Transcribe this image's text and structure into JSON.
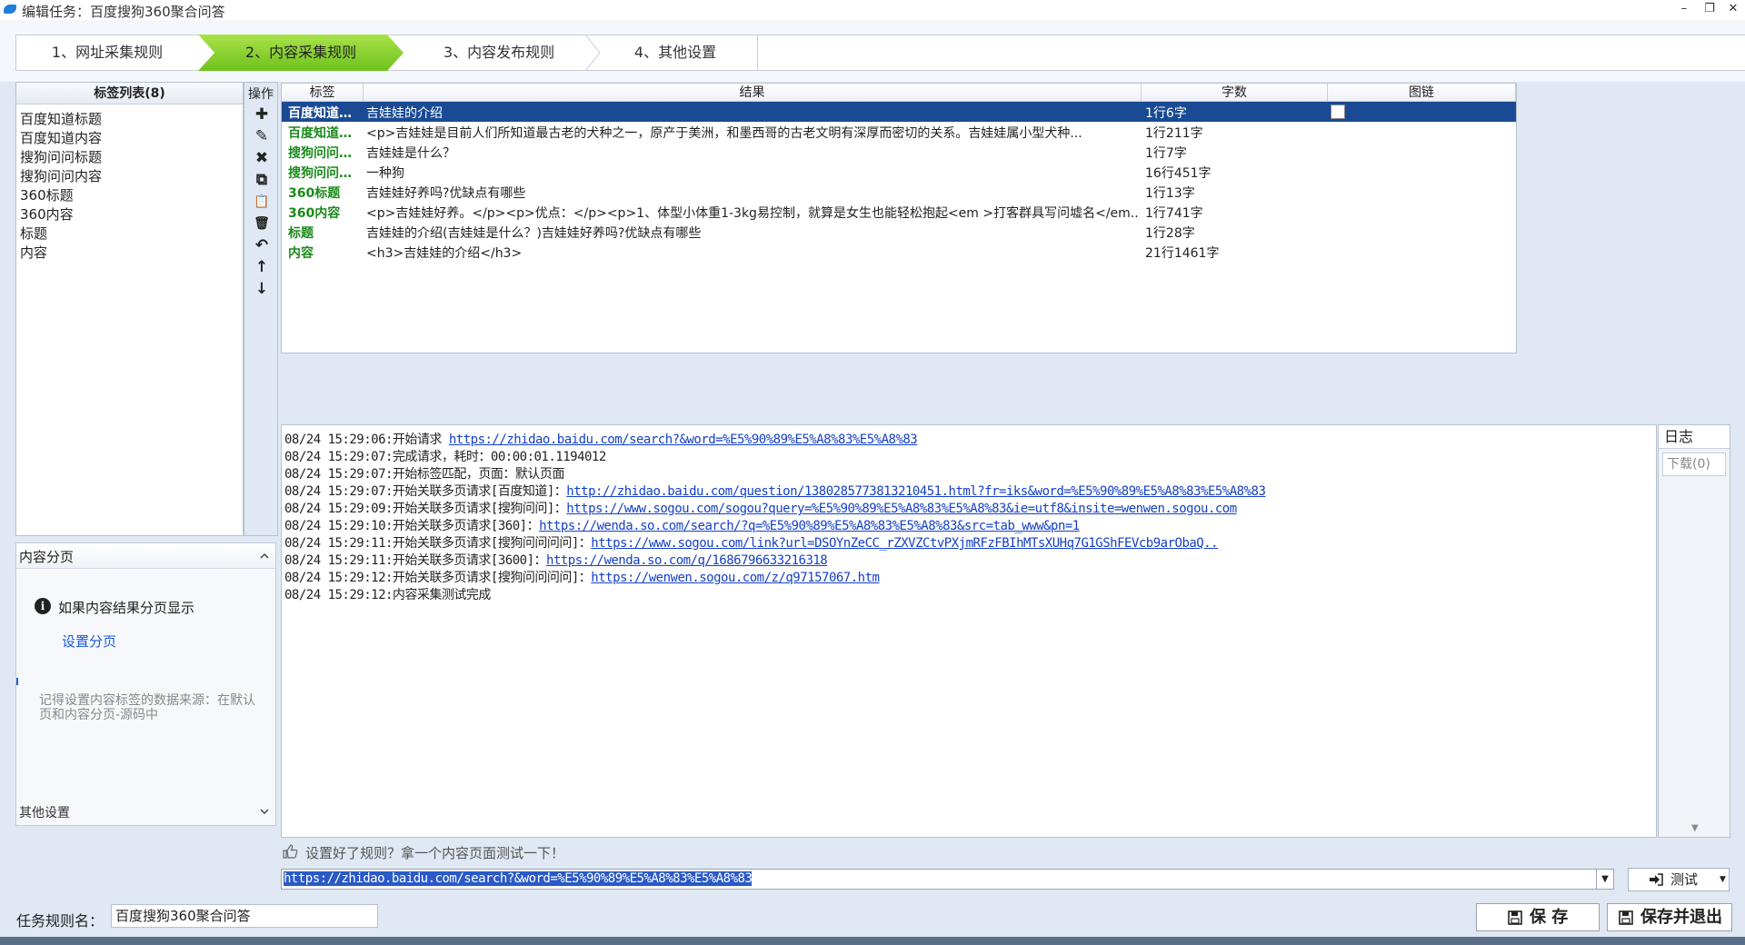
{
  "window": {
    "title": "编辑任务：百度搜狗360聚合问答",
    "minimize": "–",
    "restore": "❐",
    "close": "✕"
  },
  "wizard": {
    "steps": [
      "1、网址采集规则",
      "2、内容采集规则",
      "3、内容发布规则",
      "4、其他设置"
    ],
    "active_index": 1
  },
  "tags": {
    "header": "标签列表(8)",
    "items": [
      "百度知道标题",
      "百度知道内容",
      "搜狗问问标题",
      "搜狗问问内容",
      "360标题",
      "360内容",
      "标题",
      "内容"
    ]
  },
  "ops": {
    "title": "操作",
    "icons": [
      "add-icon",
      "edit-icon",
      "delete-icon",
      "copy-icon",
      "paste-icon",
      "trash-icon",
      "undo-icon",
      "move-up-icon",
      "move-down-icon"
    ],
    "glyphs": [
      "✚",
      "✎",
      "✖",
      "⧉",
      "📋",
      "🗑",
      "↶",
      "↑",
      "↓"
    ]
  },
  "paging": {
    "title": "内容分页",
    "info": "如果内容结果分页显示",
    "link": "设置分页",
    "note": "记得设置内容标签的数据来源：在默认页和内容分页-源码中",
    "footer": "其他设置"
  },
  "grid": {
    "headers": [
      "标签",
      "结果",
      "字数",
      "图链"
    ],
    "rows": [
      {
        "tag": "百度知道…",
        "result": "吉娃娃的介绍",
        "count": "1行6字"
      },
      {
        "tag": "百度知道…",
        "result": "<p>吉娃娃是目前人们所知道最古老的犬种之一，原产于美洲，和墨西哥的古老文明有深厚而密切的关系。吉娃娃属小型犬种...",
        "count": "1行211字"
      },
      {
        "tag": "搜狗问问…",
        "result": "吉娃娃是什么？",
        "count": "1行7字"
      },
      {
        "tag": "搜狗问问…",
        "result": "一种狗",
        "count": "16行451字"
      },
      {
        "tag": "360标题",
        "result": "吉娃娃好养吗?优缺点有哪些",
        "count": "1行13字"
      },
      {
        "tag": "360内容",
        "result": "<p>吉娃娃好养。</p><p>优点：</p><p>1、体型小体重1-3kg易控制，就算是女生也能轻松抱起<em >打客群具写问墟名</em...",
        "count": "1行741字"
      },
      {
        "tag": "标题",
        "result": "吉娃娃的介绍(吉娃娃是什么？)吉娃娃好养吗?优缺点有哪些",
        "count": "1行28字"
      },
      {
        "tag": "内容",
        "result": "<h3>吉娃娃的介绍</h3>",
        "count": "21行1461字"
      }
    ]
  },
  "log": {
    "tab": "日志",
    "download": "下载(0)",
    "lines": [
      {
        "text": "08/24 15:29:06:开始请求 ",
        "link": "https://zhidao.baidu.com/search?&word=%E5%90%89%E5%A8%83%E5%A8%83"
      },
      {
        "text": "08/24 15:29:07:完成请求，耗时：00:00:01.1194012",
        "link": ""
      },
      {
        "text": "08/24 15:29:07:开始标签匹配，页面：默认页面",
        "link": ""
      },
      {
        "text": "08/24 15:29:07:开始关联多页请求[百度知道]：",
        "link": "http://zhidao.baidu.com/question/1380285773813210451.html?fr=iks&word=%E5%90%89%E5%A8%83%E5%A8%83"
      },
      {
        "text": "08/24 15:29:09:开始关联多页请求[搜狗问问]：",
        "link": "https://www.sogou.com/sogou?query=%E5%90%89%E5%A8%83%E5%A8%83&ie=utf8&insite=wenwen.sogou.com"
      },
      {
        "text": "08/24 15:29:10:开始关联多页请求[360]：",
        "link": "https://wenda.so.com/search/?q=%E5%90%89%E5%A8%83%E5%A8%83&src=tab_www&pn=1"
      },
      {
        "text": "08/24 15:29:11:开始关联多页请求[搜狗问问问问]：",
        "link": "https://www.sogou.com/link?url=DSOYnZeCC_rZXVZCtvPXjmRFzFBIhMTsXUHq7G1GShFEVcb9arObaQ.."
      },
      {
        "text": "08/24 15:29:11:开始关联多页请求[3600]：",
        "link": "https://wenda.so.com/q/1686796633216318"
      },
      {
        "text": "08/24 15:29:12:开始关联多页请求[搜狗问问问问]：",
        "link": "https://wenwen.sogou.com/z/q97157067.htm"
      },
      {
        "text": "08/24 15:29:12:内容采集测试完成",
        "link": ""
      }
    ]
  },
  "test": {
    "hint": "设置好了规则？拿一个内容页面测试一下！",
    "url": "https://zhidao.baidu.com/search?&word=%E5%90%89%E5%A8%83%E5%A8%83",
    "button": "测试"
  },
  "task": {
    "label": "任务规则名：",
    "name": "百度搜狗360聚合问答",
    "save": "保 存",
    "save_exit": "保存并退出"
  }
}
